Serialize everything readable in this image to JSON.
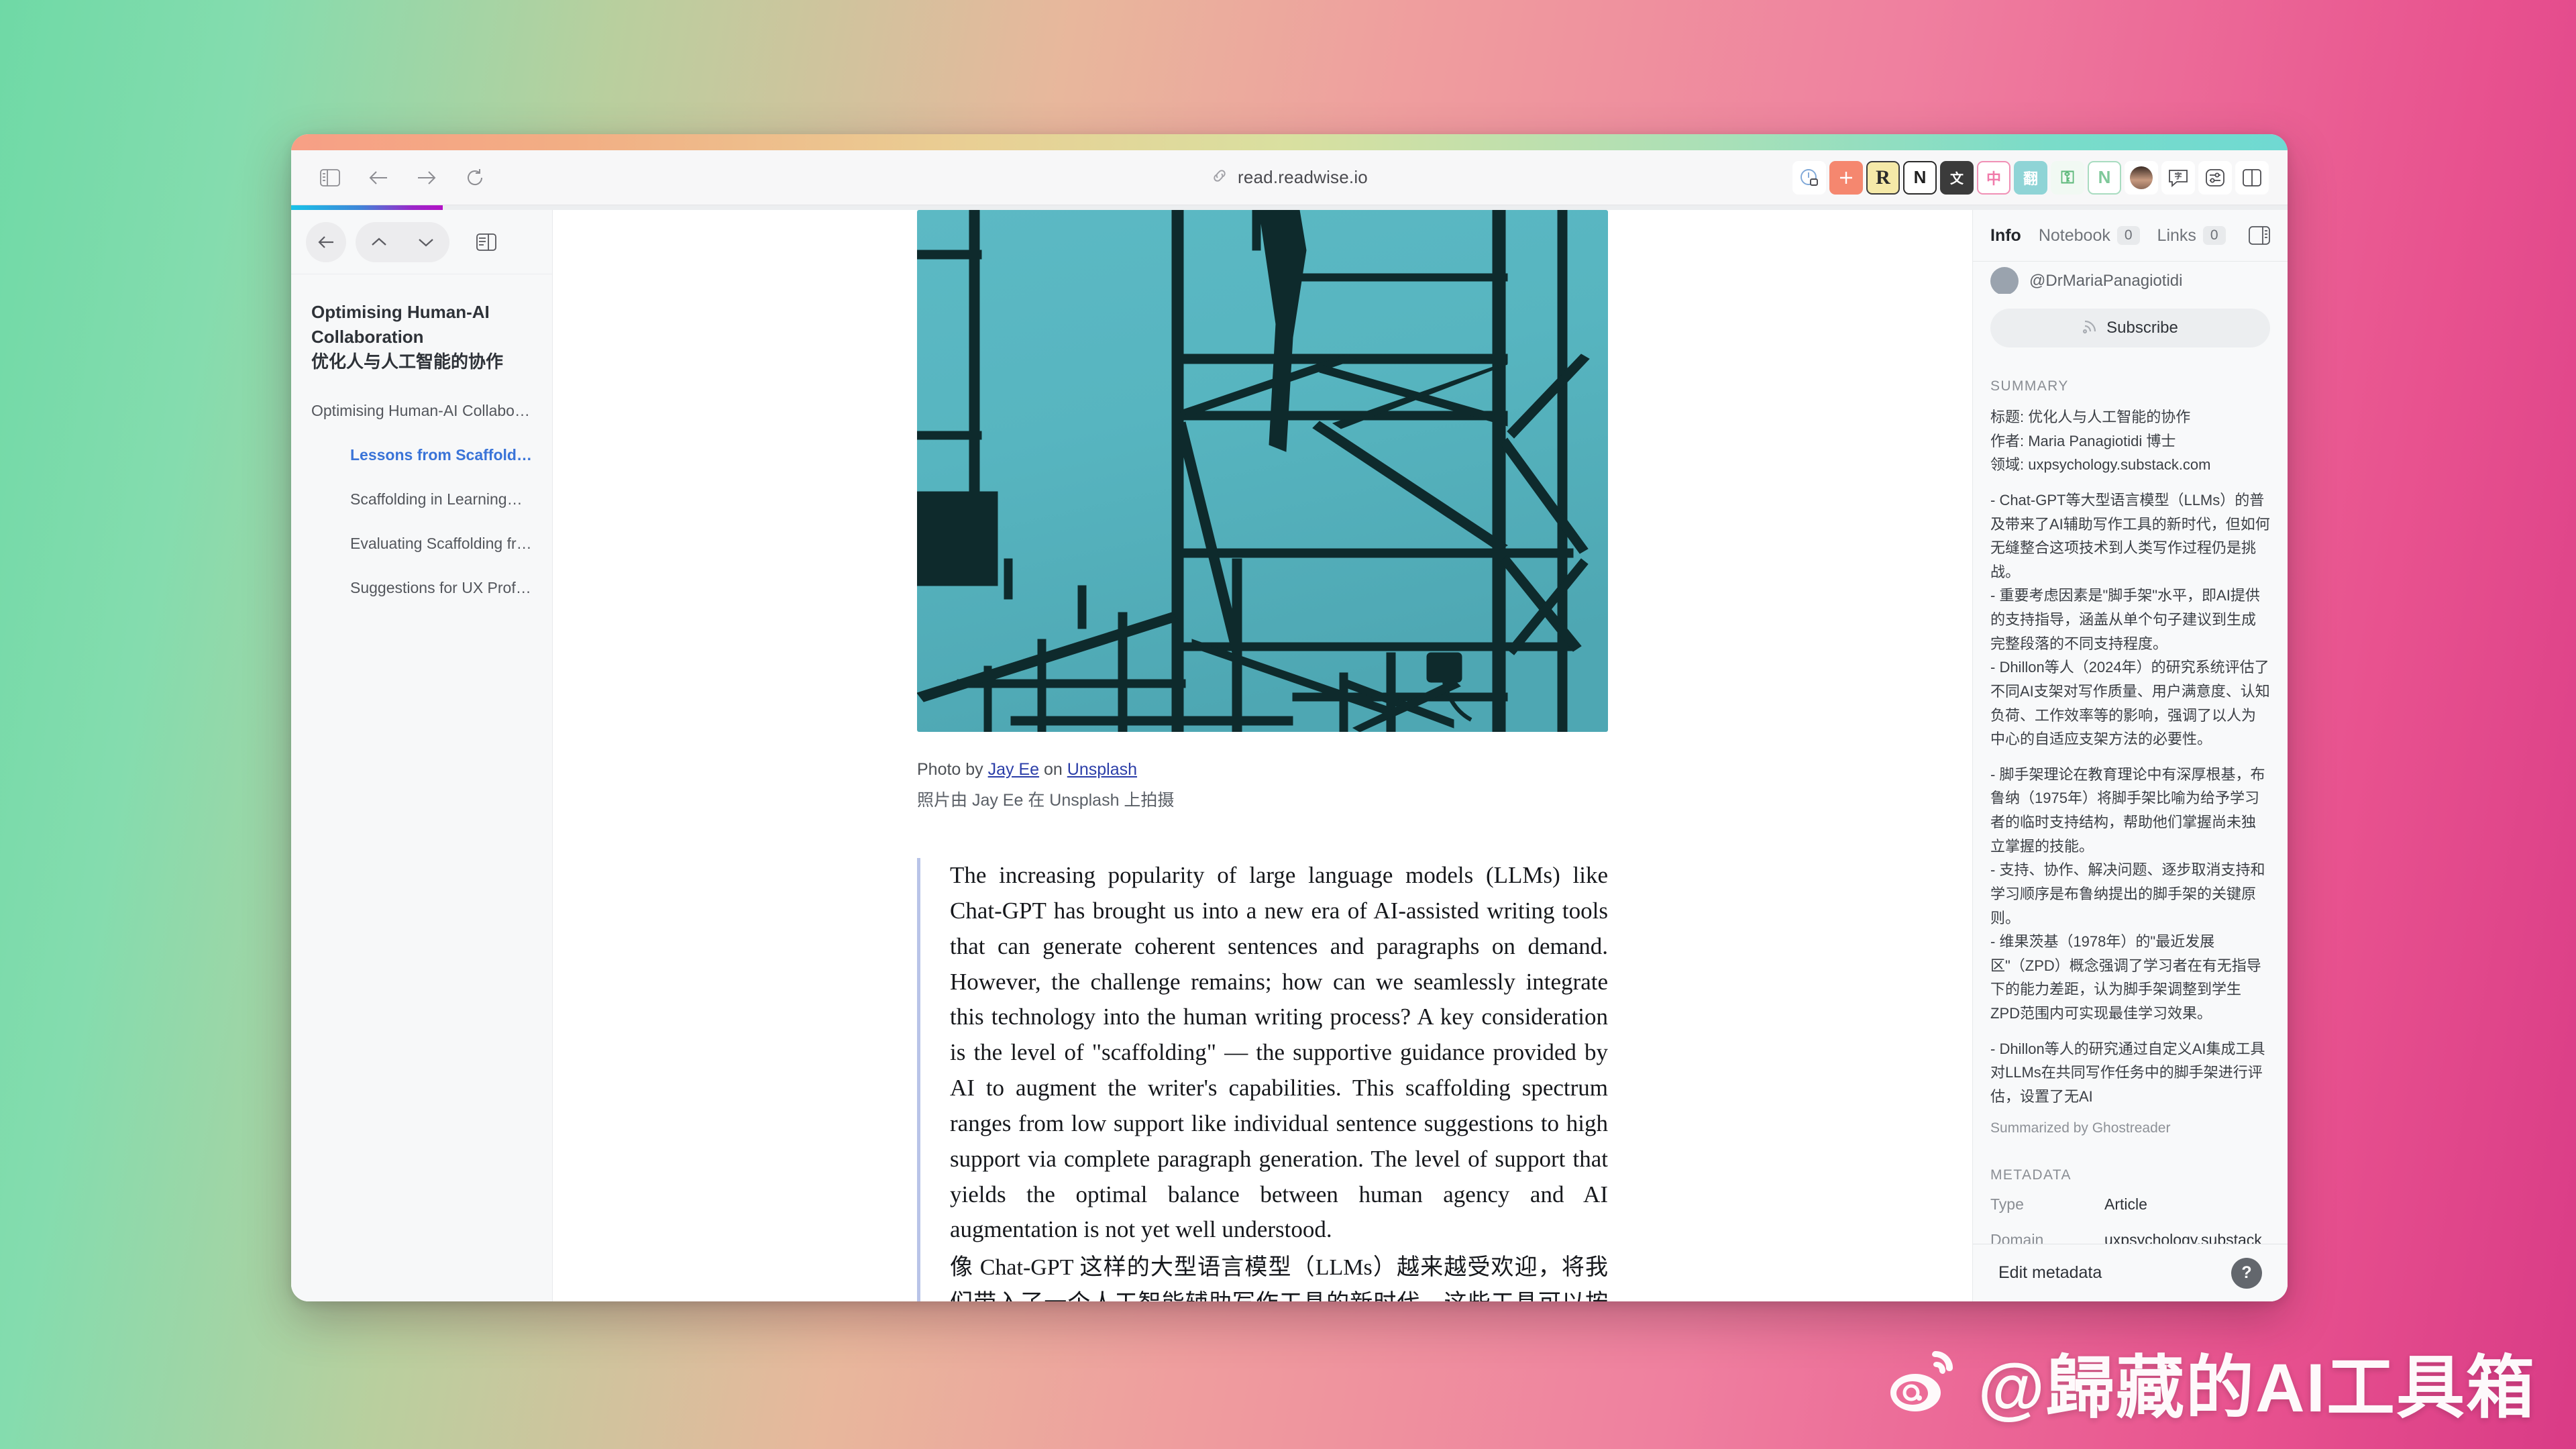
{
  "browser": {
    "url": "read.readwise.io",
    "url_icon": "link-icon",
    "nav": {
      "sidebar_toggle": "sidebar-toggle-icon",
      "back": "back-arrow-icon",
      "forward": "forward-arrow-icon",
      "reload": "reload-icon"
    },
    "extensions": [
      {
        "name": "privacy-badger-icon",
        "glyph": "ⓘ",
        "bg": "#ffffff",
        "fg": "#7fa8d8"
      },
      {
        "name": "add-extension-icon",
        "glyph": "+",
        "bg": "#f5876f",
        "fg": "#ffffff"
      },
      {
        "name": "readwise-icon",
        "glyph": "R",
        "bg": "#f5e9a8",
        "fg": "#2b2b2b"
      },
      {
        "name": "notion-web-clipper-icon",
        "glyph": "N",
        "bg": "#ffffff",
        "fg": "#1f1f1f"
      },
      {
        "name": "translate-tool-icon",
        "glyph": "文",
        "bg": "#3b3b3b",
        "fg": "#ffffff"
      },
      {
        "name": "chinese-dictionary-icon",
        "glyph": "中",
        "bg": "#f7a8c4",
        "fg": "#ffffff"
      },
      {
        "name": "immersive-translate-icon",
        "glyph": "翻",
        "bg": "#8fd4d6",
        "fg": "#ffffff"
      },
      {
        "name": "key-icon",
        "glyph": "⚷",
        "bg": "#eef7f0",
        "fg": "#5cb87a"
      },
      {
        "name": "notion-icon",
        "glyph": "N",
        "bg": "#ffffff",
        "fg": "#7fc89a"
      },
      {
        "name": "profile-avatar-icon",
        "glyph": "●",
        "bg": "#6b4f42",
        "fg": "#d8a88a"
      },
      {
        "name": "subtitle-translate-icon",
        "glyph": "字",
        "bg": "#ffffff",
        "fg": "#4a4a4f"
      },
      {
        "name": "settings-sliders-icon",
        "glyph": "≡",
        "bg": "#ffffff",
        "fg": "#4a4a4f"
      },
      {
        "name": "split-view-icon",
        "glyph": "▧",
        "bg": "#ffffff",
        "fg": "#4a4a4f"
      }
    ],
    "progress_percent": 8
  },
  "sidebar": {
    "controls": {
      "back": "back-arrow-icon",
      "prev": "chevron-up-icon",
      "next": "chevron-down-icon",
      "panel_toggle": "sidebar-panel-icon"
    },
    "doc_title_en": "Optimising Human-AI Collaboration",
    "doc_title_zh": "优化人与人工智能的协作",
    "toc": [
      {
        "label": "Optimising Human-AI Collaboration...",
        "level": 1,
        "active": false
      },
      {
        "label": "Lessons from Scaffolding The...",
        "level": 2,
        "active": true
      },
      {
        "label": "Scaffolding in Learning学习中...",
        "level": 2,
        "active": false
      },
      {
        "label": "Evaluating Scaffolding from LL...",
        "level": 2,
        "active": false
      },
      {
        "label": "Suggestions for UX Profession...",
        "level": 2,
        "active": false
      }
    ]
  },
  "article": {
    "caption_prefix": "Photo by ",
    "caption_author": "Jay Ee",
    "caption_mid": " on ",
    "caption_source": "Unsplash",
    "caption_zh": "照片由 Jay Ee 在 Unsplash 上拍摄",
    "paragraph_en": "The increasing popularity of large language models (LLMs) like Chat-GPT has brought us into a new era of AI-assisted writing tools that can generate coherent sentences and paragraphs on demand. However, the challenge remains; how can we seamlessly integrate this technology into the human writing process? A key consideration is the level of \"scaffolding\" — the supportive guidance provided by AI to augment the writer's capabilities. This scaffolding spectrum ranges from low support like individual sentence suggestions to high support via complete paragraph generation. The level of support that yields the optimal balance between human agency and AI augmentation is not yet well understood.",
    "paragraph_zh": "像 Chat-GPT 这样的大型语言模型（LLMs）越来越受欢迎，将我们带入了一个人工智能辅助写作工具的新时代，这些工具可以按需生成连贯的句子和段落。然而，挑战依然存在：我们如何才能将这项技术"
  },
  "right_panel": {
    "tabs": [
      {
        "label": "Info",
        "count": null,
        "active": true
      },
      {
        "label": "Notebook",
        "count": "0",
        "active": false
      },
      {
        "label": "Links",
        "count": "0",
        "active": false
      }
    ],
    "panel_toggle_icon": "right-panel-toggle-icon",
    "author_handle": "@DrMariaPanagiotidi",
    "subscribe_label": "Subscribe",
    "subscribe_icon": "rss-icon",
    "summary_label": "SUMMARY",
    "summary_paragraphs": [
      "标题: 优化人与人工智能的协作\n作者: Maria Panagiotidi 博士\n领域: uxpsychology.substack.com",
      "- Chat-GPT等大型语言模型（LLMs）的普及带来了AI辅助写作工具的新时代，但如何无缝整合这项技术到人类写作过程仍是挑战。\n- 重要考虑因素是\"脚手架\"水平，即AI提供的支持指导，涵盖从单个句子建议到生成完整段落的不同支持程度。\n- Dhillon等人（2024年）的研究系统评估了不同AI支架对写作质量、用户满意度、认知负荷、工作效率等的影响，强调了以人为中心的自适应支架方法的必要性。",
      "- 脚手架理论在教育理论中有深厚根基，布鲁纳（1975年）将脚手架比喻为给予学习者的临时支持结构，帮助他们掌握尚未独立掌握的技能。\n- 支持、协作、解决问题、逐步取消支持和学习顺序是布鲁纳提出的脚手架的关键原则。\n- 维果茨基（1978年）的\"最近发展区\"（ZPD）概念强调了学习者在有无指导下的能力差距，认为脚手架调整到学生ZPD范围内可实现最佳学习效果。",
      "- Dhillon等人的研究通过自定义AI集成工具对LLMs在共同写作任务中的脚手架进行评估，设置了无AI"
    ],
    "summary_credit": "Summarized by Ghostreader",
    "metadata_label": "METADATA",
    "metadata_rows": [
      {
        "key": "Type",
        "value": "Article"
      },
      {
        "key": "Domain",
        "value": "uxpsychology.substack"
      }
    ],
    "edit_metadata_label": "Edit metadata",
    "help_label": "?"
  },
  "watermark": {
    "text": "@歸藏的AI工具箱",
    "icon": "weibo-logo-icon"
  },
  "colors": {
    "accent_link": "#3a74d8",
    "progress_start": "#18c3e8",
    "progress_end": "#b312c6",
    "quote_bar": "#b9c4e8"
  }
}
